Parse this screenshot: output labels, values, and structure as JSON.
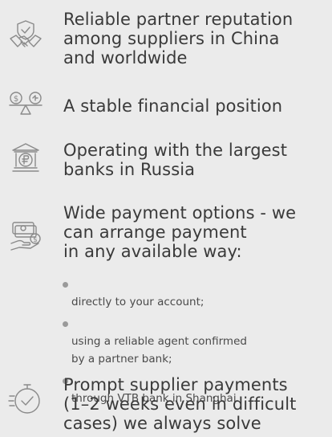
{
  "features": [
    {
      "icon": "handshake-icon",
      "text": "Reliable partner reputation\namong suppliers in China\nand worldwide"
    },
    {
      "icon": "balance-scale-icon",
      "text": "A stable financial position"
    },
    {
      "icon": "bank-ruble-icon",
      "text": "Operating with the largest\nbanks in Russia"
    },
    {
      "icon": "payment-hand-icon",
      "text": "Wide payment options - we\ncan arrange payment\nin any available way:",
      "bullets": [
        "directly to your account;",
        "using a reliable agent confirmed\nby a partner bank;",
        "through VTB bank in Shanghai"
      ]
    },
    {
      "icon": "stopwatch-check-icon",
      "text": "Prompt supplier payments\n(1–2 weeks even in difficult\ncases) we always solve"
    }
  ]
}
